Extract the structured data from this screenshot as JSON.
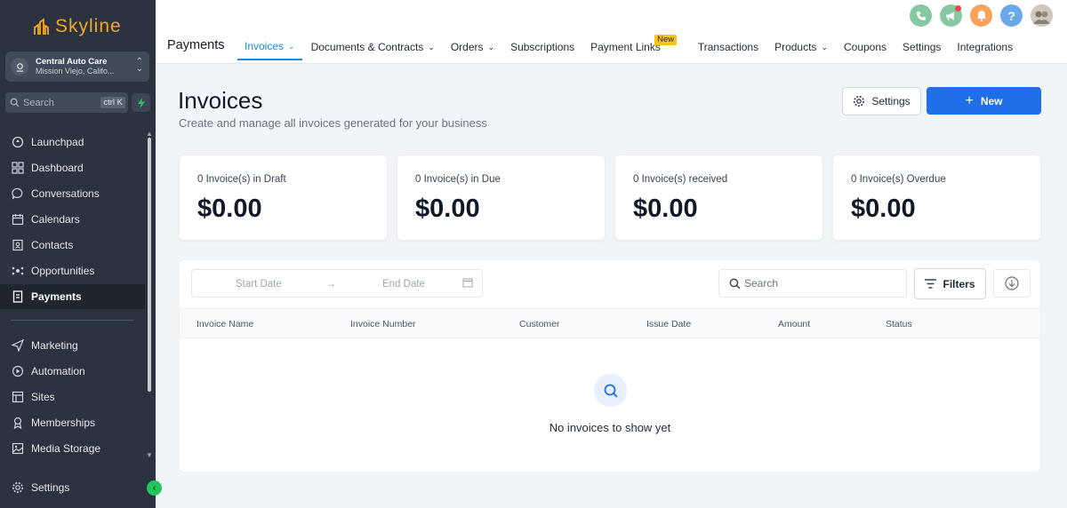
{
  "brand": {
    "name": "Skyline"
  },
  "location": {
    "name": "Central Auto Care",
    "address": "Mission Viejo, Califo..."
  },
  "sidebar": {
    "search_placeholder": "Search",
    "search_shortcut": "ctrl K",
    "items": [
      {
        "label": "Launchpad",
        "icon": "rocket-icon"
      },
      {
        "label": "Dashboard",
        "icon": "dashboard-icon"
      },
      {
        "label": "Conversations",
        "icon": "chat-icon"
      },
      {
        "label": "Calendars",
        "icon": "calendar-icon"
      },
      {
        "label": "Contacts",
        "icon": "contacts-icon"
      },
      {
        "label": "Opportunities",
        "icon": "opportunities-icon"
      },
      {
        "label": "Payments",
        "icon": "payments-icon",
        "active": true
      }
    ],
    "items2": [
      {
        "label": "Marketing",
        "icon": "send-icon"
      },
      {
        "label": "Automation",
        "icon": "automation-icon"
      },
      {
        "label": "Sites",
        "icon": "sites-icon"
      },
      {
        "label": "Memberships",
        "icon": "membership-icon"
      },
      {
        "label": "Media Storage",
        "icon": "media-icon"
      }
    ],
    "settings_label": "Settings"
  },
  "header": {
    "page_label": "Payments",
    "tabs": [
      {
        "label": "Invoices",
        "active": true,
        "dropdown": true
      },
      {
        "label": "Documents & Contracts",
        "dropdown": true
      },
      {
        "label": "Orders",
        "dropdown": true
      },
      {
        "label": "Subscriptions"
      },
      {
        "label": "Payment Links",
        "badge": "New"
      },
      {
        "label": "Transactions"
      },
      {
        "label": "Products",
        "dropdown": true
      },
      {
        "label": "Coupons"
      },
      {
        "label": "Settings"
      },
      {
        "label": "Integrations"
      }
    ],
    "icons": [
      "phone-icon",
      "megaphone-icon",
      "bell-icon",
      "help-icon",
      "user-avatar"
    ]
  },
  "main": {
    "title": "Invoices",
    "subtitle": "Create and manage all invoices generated for your business",
    "settings_button": "Settings",
    "new_button": "New",
    "cards": [
      {
        "label": "0 Invoice(s) in Draft",
        "value": "$0.00"
      },
      {
        "label": "0 Invoice(s) in Due",
        "value": "$0.00"
      },
      {
        "label": "0 Invoice(s) received",
        "value": "$0.00"
      },
      {
        "label": "0 Invoice(s) Overdue",
        "value": "$0.00"
      }
    ],
    "table": {
      "start_date_placeholder": "Start Date",
      "end_date_placeholder": "End Date",
      "search_placeholder": "Search",
      "filters_label": "Filters",
      "columns": [
        "Invoice Name",
        "Invoice Number",
        "Customer",
        "Issue Date",
        "Amount",
        "Status"
      ],
      "empty_message": "No invoices to show yet"
    }
  },
  "colors": {
    "accent": "#1e6fe8",
    "brand": "#f5a623",
    "sidebar_bg": "#2b3340"
  }
}
